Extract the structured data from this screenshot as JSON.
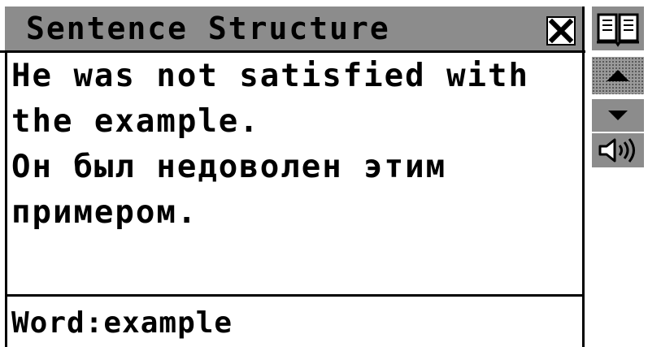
{
  "window": {
    "title": "Sentence Structure"
  },
  "sentence": {
    "lines": [
      "He was not satisfied with",
      "the example.",
      "Он был недоволен этим",
      "примером."
    ]
  },
  "word": {
    "text": "Word:example"
  },
  "icons": {
    "close": "close-icon",
    "dictionary": "book-icon",
    "scroll_up": "arrow-up-icon",
    "scroll_down": "arrow-down-icon",
    "speaker": "speaker-icon"
  },
  "colors": {
    "titlebar": "#8c8c8c",
    "text": "#000000",
    "background": "#ffffff"
  }
}
